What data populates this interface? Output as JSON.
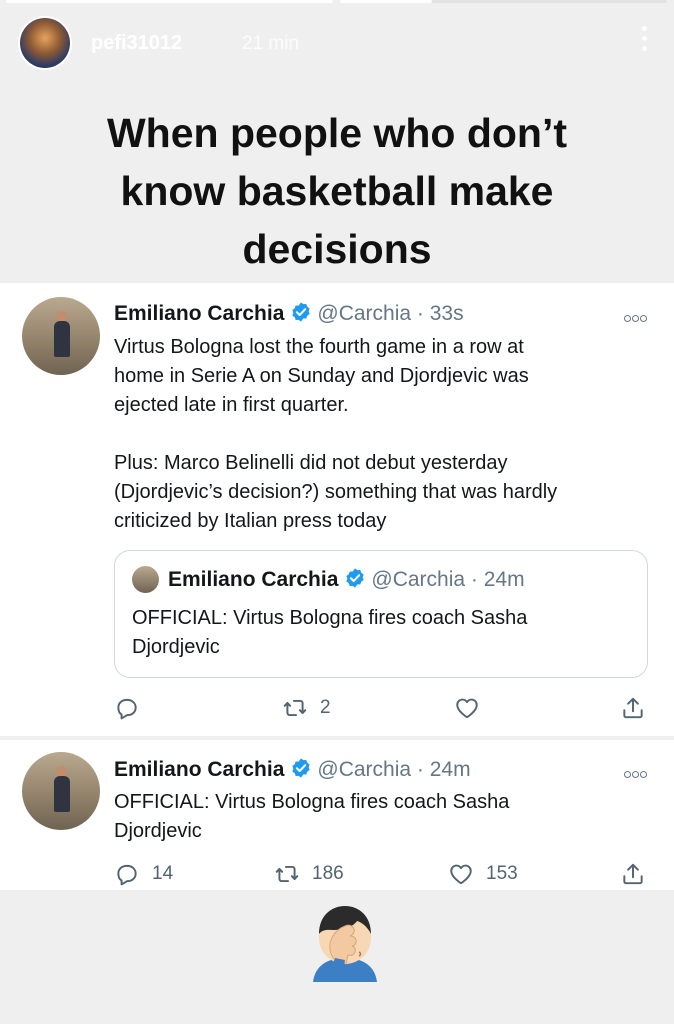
{
  "story": {
    "username": "pefi31012",
    "time": "21 min",
    "caption_lines": [
      "When people who don’t",
      "know basketball make",
      "decisions"
    ]
  },
  "tweet1": {
    "name": "Emiliano Carchia",
    "handle": "@Carchia",
    "time": "· 33s",
    "text_p1": [
      "Virtus Bologna lost the fourth game in a row at",
      "home in Serie A on Sunday and Djordjevic was",
      "ejected late in first quarter."
    ],
    "text_p2": [
      "Plus: Marco Belinelli did not debut yesterday",
      "(Djordjevic’s decision?) something that was hardly",
      "criticized by Italian press today"
    ],
    "quote": {
      "name": "Emiliano Carchia",
      "handle": "@Carchia",
      "time": "· 24m",
      "text": [
        "OFFICIAL: Virtus Bologna fires coach Sasha",
        "Djordjevic"
      ]
    },
    "stats": {
      "replies": "",
      "retweets": "2",
      "likes": ""
    }
  },
  "tweet2": {
    "name": "Emiliano Carchia",
    "handle": "@Carchia",
    "time": "· 24m",
    "text": [
      "OFFICIAL: Virtus Bologna fires coach Sasha",
      "Djordjevic"
    ],
    "stats": {
      "replies": "14",
      "retweets": "186",
      "likes": "153"
    }
  },
  "sticker": "facepalm-emoji",
  "colors": {
    "verified": "#1d9bf0",
    "text": "#14171a",
    "muted": "#657786",
    "background": "#efefef"
  }
}
